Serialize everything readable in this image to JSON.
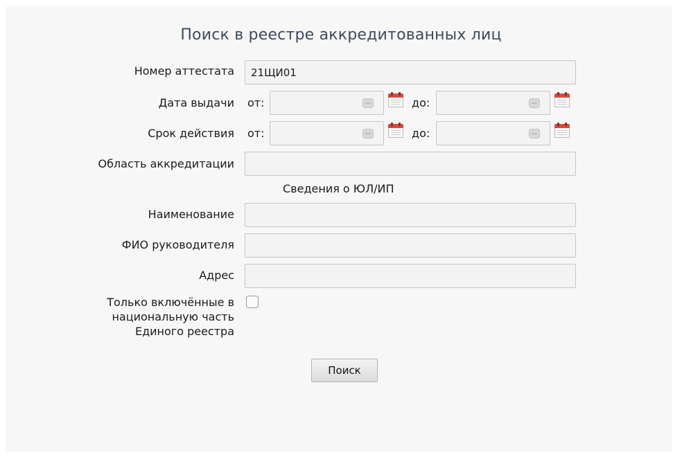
{
  "form": {
    "title": "Поиск в реестре аккредитованных лиц",
    "fields": {
      "certificate_number": {
        "label": "Номер аттестата",
        "value": "21ЩИ01"
      },
      "issue_date": {
        "label": "Дата выдачи",
        "from_label": "от:",
        "to_label": "до:",
        "from_value": "",
        "to_value": ""
      },
      "validity": {
        "label": "Срок действия",
        "from_label": "от:",
        "to_label": "до:",
        "from_value": "",
        "to_value": ""
      },
      "accreditation_area": {
        "label": "Область аккредитации",
        "value": ""
      }
    },
    "section_title": "Сведения о ЮЛ/ИП",
    "entity": {
      "name": {
        "label": "Наименование",
        "value": ""
      },
      "director": {
        "label": "ФИО руководителя",
        "value": ""
      },
      "address": {
        "label": "Адрес",
        "value": ""
      }
    },
    "national_only": {
      "label": "Только включённые в национальную часть Единого реестра",
      "checked": false
    },
    "search_button": "Поиск"
  },
  "icons": {
    "calendar": "calendar-icon",
    "clear": "clear-icon"
  },
  "colors": {
    "title": "#3d4a5c",
    "field_bg": "#f3f3f3",
    "calendar_red": "#d84a3c"
  }
}
